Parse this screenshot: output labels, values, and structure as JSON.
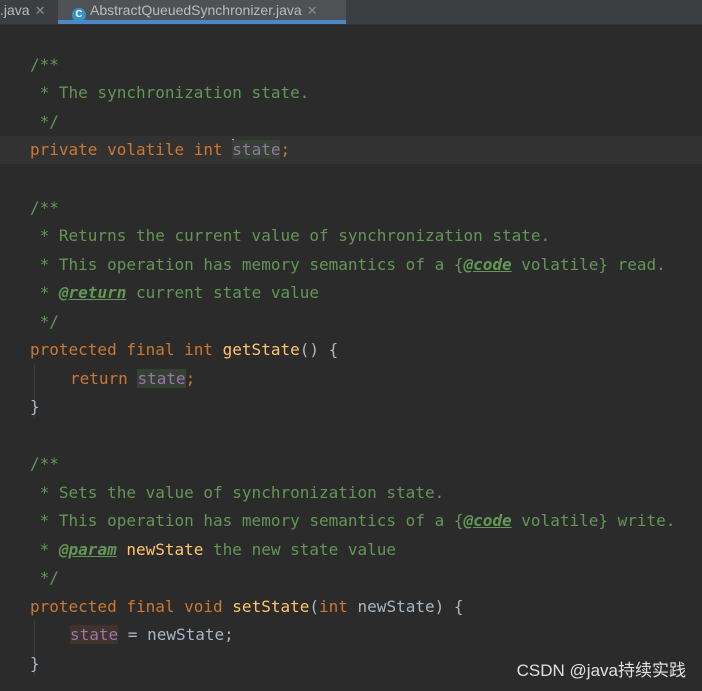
{
  "tabs": [
    {
      "label": ".java",
      "active": false
    },
    {
      "label": "AbstractQueuedSynchronizer.java",
      "active": true
    }
  ],
  "icons": {
    "close": "close-icon",
    "class": "java-class-icon"
  },
  "code": {
    "l1": "/**",
    "l2": " * The synchronization state.",
    "l3": " */",
    "l4_kw": "private volatile int ",
    "l4_field": "state",
    "l4_end": ";",
    "l6": "/**",
    "l7": " * Returns the current value of synchronization state.",
    "l8_a": " * This operation has memory semantics of a {",
    "l8_tag": "@code",
    "l8_b": " volatile} read.",
    "l9_a": " * ",
    "l9_tag": "@return",
    "l9_b": " current state value",
    "l10": " */",
    "l11_kw": "protected final int ",
    "l11_fn": "getState",
    "l11_end": "() {",
    "l12_kw": "return ",
    "l12_field": "state",
    "l12_end": ";",
    "l13": "}",
    "l15": "/**",
    "l16": " * Sets the value of synchronization state.",
    "l17_a": " * This operation has memory semantics of a {",
    "l17_tag": "@code",
    "l17_b": " volatile} write.",
    "l18_a": " * ",
    "l18_tag": "@param",
    "l18_pv": " newState",
    "l18_b": " the new state value",
    "l19": " */",
    "l20_kw": "protected final void ",
    "l20_fn": "setState",
    "l20_p1": "(",
    "l20_kw2": "int",
    "l20_p2": " newState) {",
    "l21_field": "state",
    "l21_end": " = newState;",
    "l22": "}"
  },
  "watermark": "CSDN @java持续实践",
  "colors": {
    "background": "#2b2b2b",
    "comment": "#629755",
    "keyword": "#cc7832",
    "method": "#ffc66d",
    "field": "#9876aa",
    "tab_accent": "#4a88c7"
  }
}
